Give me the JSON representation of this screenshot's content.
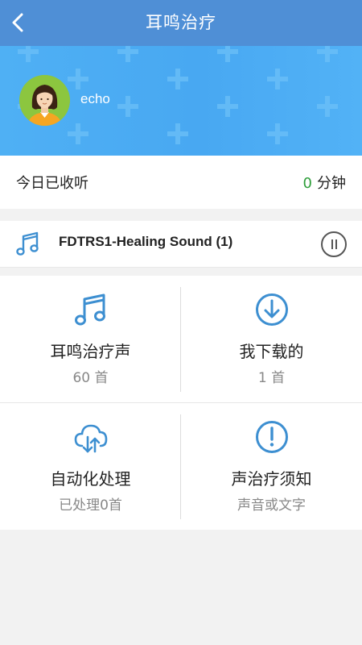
{
  "header": {
    "title": "耳鸣治疗"
  },
  "profile": {
    "username": "echo"
  },
  "today": {
    "label": "今日已收听",
    "count": "0",
    "unit": "分钟"
  },
  "now_playing": {
    "track": "FDTRS1-Healing Sound (1)"
  },
  "grid": [
    {
      "name": "耳鸣治疗声",
      "sub": "60 首",
      "icon": "music-note-icon"
    },
    {
      "name": "我下载的",
      "sub": "1 首",
      "icon": "download-icon"
    },
    {
      "name": "自动化处理",
      "sub": "已处理0首",
      "icon": "cloud-transfer-icon"
    },
    {
      "name": "声治疗须知",
      "sub": "声音或文字",
      "icon": "exclamation-icon"
    }
  ],
  "colors": {
    "header": "#4f8fd6",
    "banner": "#4fb0f4",
    "icon_blue": "#3d8fd1",
    "accent_green": "#2e9e3a"
  }
}
